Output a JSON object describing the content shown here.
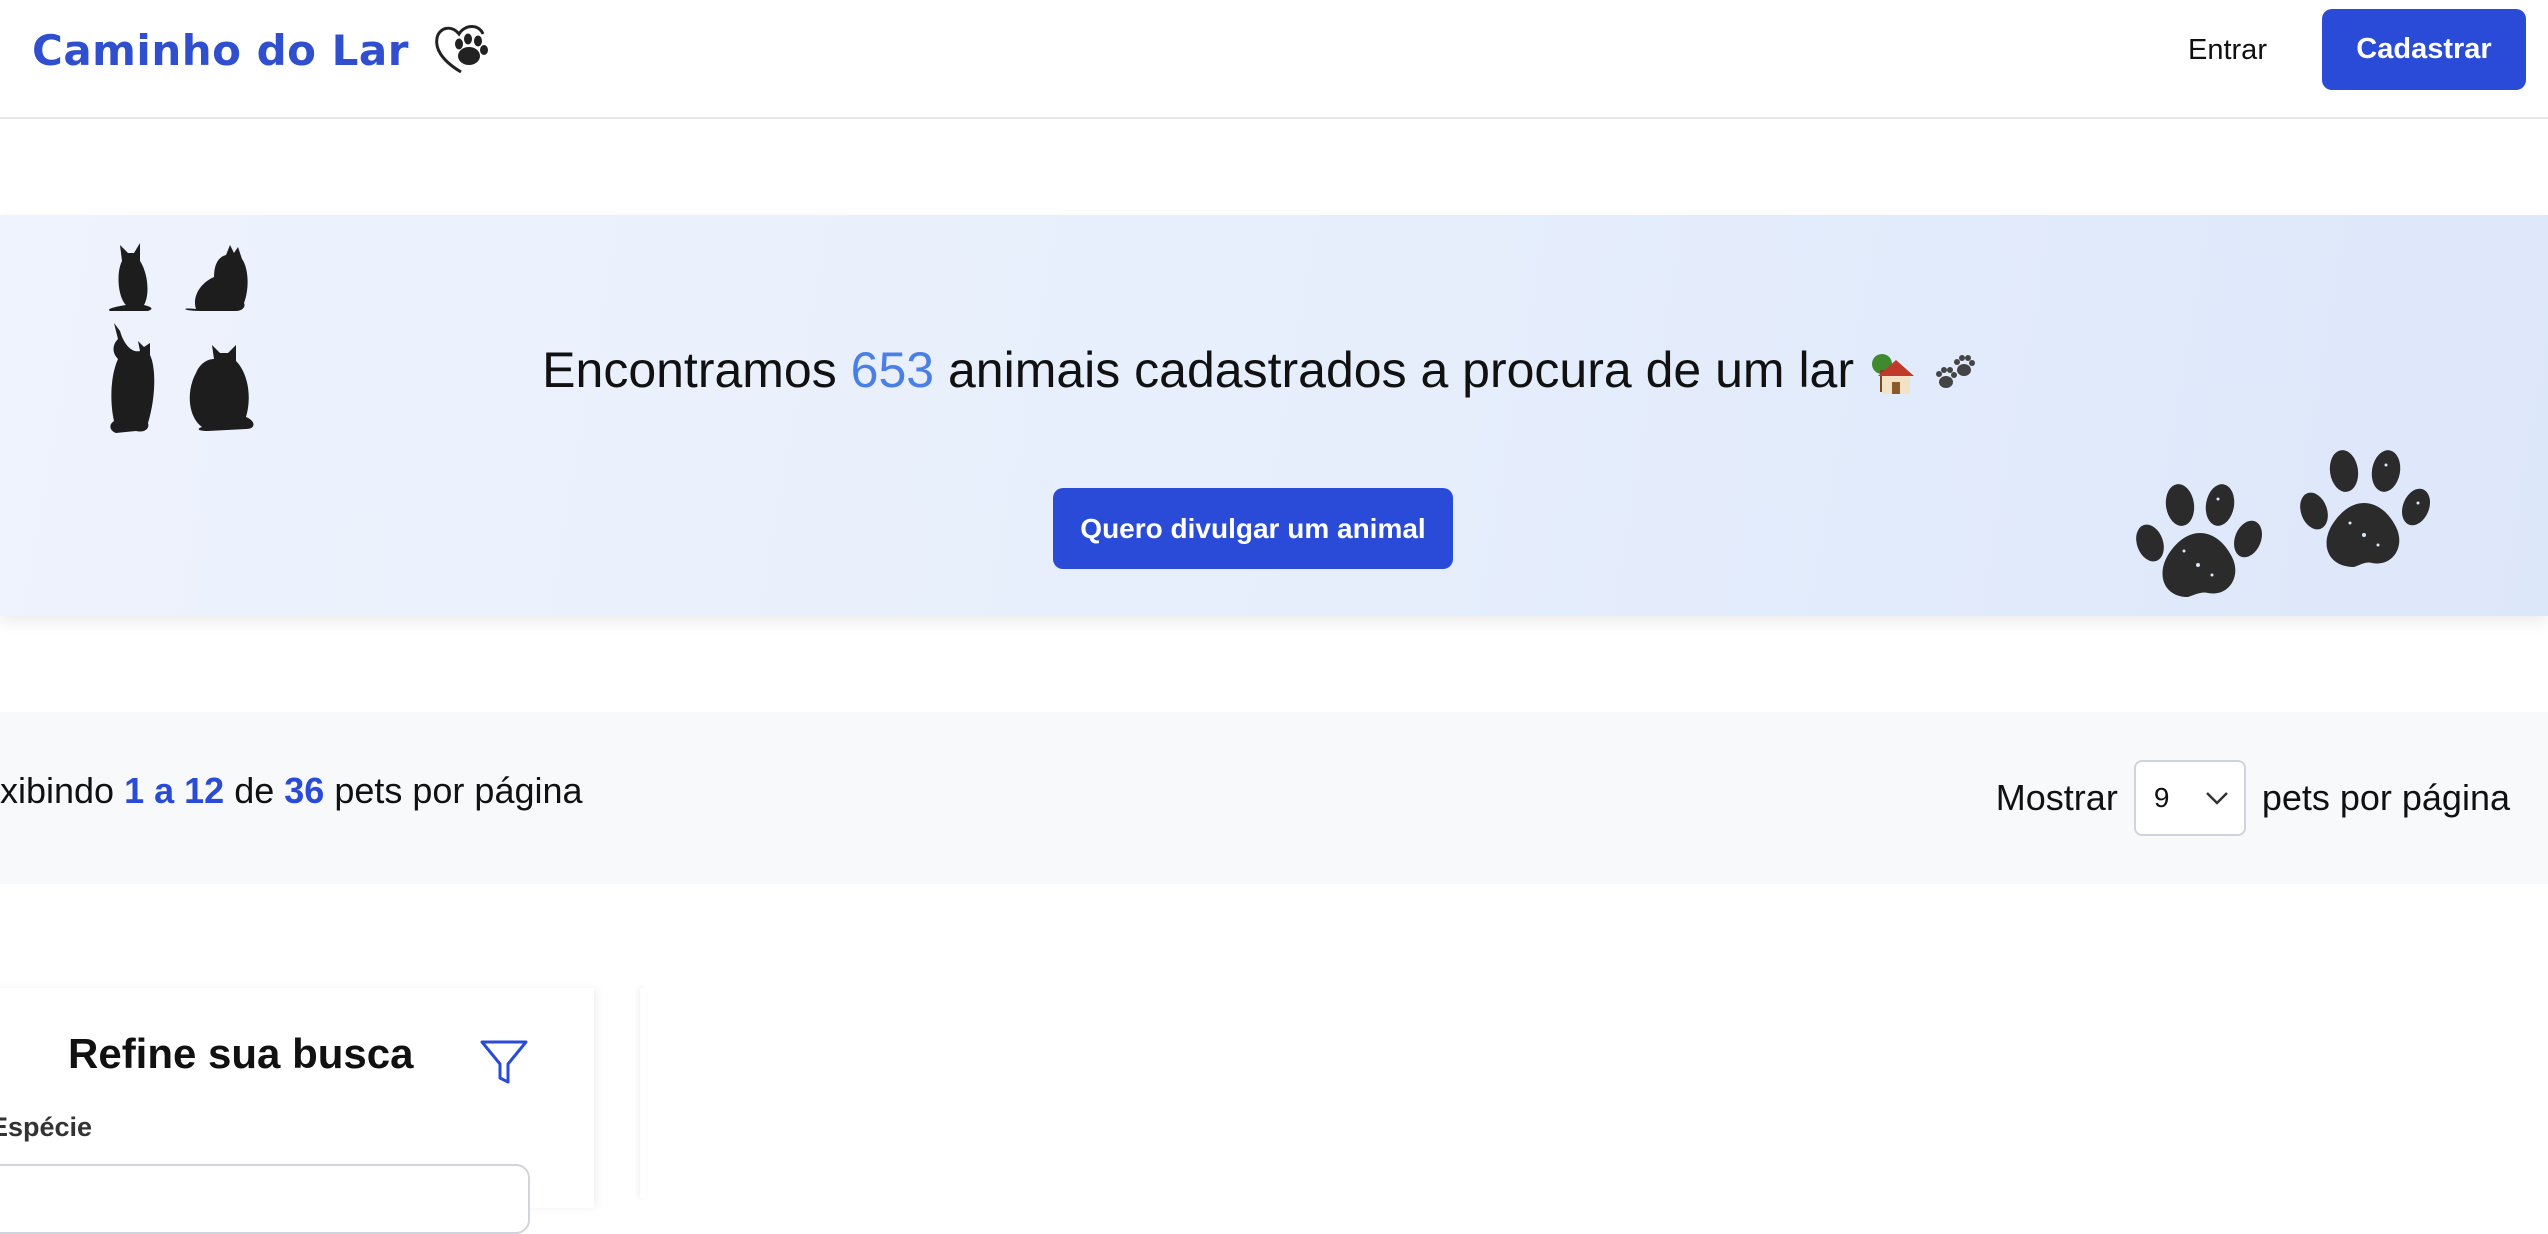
{
  "header": {
    "brand": "Caminho do Lar",
    "login_label": "Entrar",
    "register_label": "Cadastrar"
  },
  "hero": {
    "title_prefix": "Encontramos",
    "count": "653",
    "title_suffix": "animais cadastrados a procura de um lar",
    "cta_label": "Quero divulgar um animal"
  },
  "results": {
    "prefix": "xibindo",
    "range": "1 a 12",
    "of": "de",
    "total": "36",
    "suffix": "pets por página",
    "show_label": "Mostrar",
    "per_page_value": "9",
    "per_page_suffix": "pets por página"
  },
  "sidebar": {
    "title": "Refine sua busca",
    "species_label": "Espécie"
  },
  "colors": {
    "brand": "#2f4fcf",
    "primary_button": "#2a4bd7",
    "count_highlight": "#4a7fe6"
  },
  "icons": [
    "paw-heart-logo-icon",
    "cat-silhouettes-icon",
    "house-emoji-icon",
    "paws-emoji-icon",
    "paw-prints-icon",
    "chevron-down-icon",
    "filter-icon"
  ]
}
